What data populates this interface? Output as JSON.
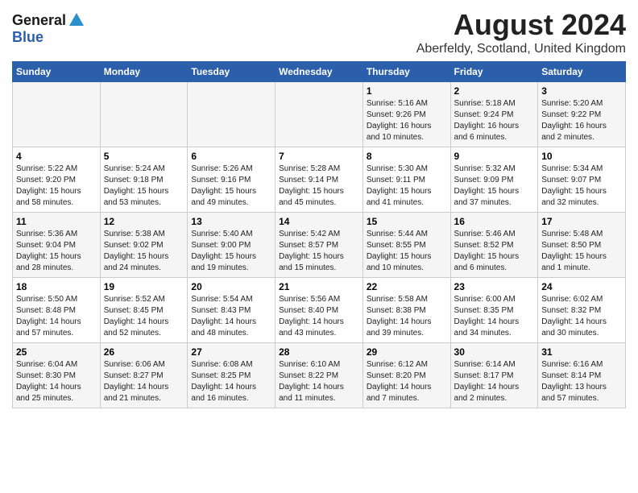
{
  "logo": {
    "general": "General",
    "blue": "Blue"
  },
  "title": "August 2024",
  "subtitle": "Aberfeldy, Scotland, United Kingdom",
  "days_of_week": [
    "Sunday",
    "Monday",
    "Tuesday",
    "Wednesday",
    "Thursday",
    "Friday",
    "Saturday"
  ],
  "weeks": [
    [
      {
        "day": "",
        "info": ""
      },
      {
        "day": "",
        "info": ""
      },
      {
        "day": "",
        "info": ""
      },
      {
        "day": "",
        "info": ""
      },
      {
        "day": "1",
        "info": "Sunrise: 5:16 AM\nSunset: 9:26 PM\nDaylight: 16 hours\nand 10 minutes."
      },
      {
        "day": "2",
        "info": "Sunrise: 5:18 AM\nSunset: 9:24 PM\nDaylight: 16 hours\nand 6 minutes."
      },
      {
        "day": "3",
        "info": "Sunrise: 5:20 AM\nSunset: 9:22 PM\nDaylight: 16 hours\nand 2 minutes."
      }
    ],
    [
      {
        "day": "4",
        "info": "Sunrise: 5:22 AM\nSunset: 9:20 PM\nDaylight: 15 hours\nand 58 minutes."
      },
      {
        "day": "5",
        "info": "Sunrise: 5:24 AM\nSunset: 9:18 PM\nDaylight: 15 hours\nand 53 minutes."
      },
      {
        "day": "6",
        "info": "Sunrise: 5:26 AM\nSunset: 9:16 PM\nDaylight: 15 hours\nand 49 minutes."
      },
      {
        "day": "7",
        "info": "Sunrise: 5:28 AM\nSunset: 9:14 PM\nDaylight: 15 hours\nand 45 minutes."
      },
      {
        "day": "8",
        "info": "Sunrise: 5:30 AM\nSunset: 9:11 PM\nDaylight: 15 hours\nand 41 minutes."
      },
      {
        "day": "9",
        "info": "Sunrise: 5:32 AM\nSunset: 9:09 PM\nDaylight: 15 hours\nand 37 minutes."
      },
      {
        "day": "10",
        "info": "Sunrise: 5:34 AM\nSunset: 9:07 PM\nDaylight: 15 hours\nand 32 minutes."
      }
    ],
    [
      {
        "day": "11",
        "info": "Sunrise: 5:36 AM\nSunset: 9:04 PM\nDaylight: 15 hours\nand 28 minutes."
      },
      {
        "day": "12",
        "info": "Sunrise: 5:38 AM\nSunset: 9:02 PM\nDaylight: 15 hours\nand 24 minutes."
      },
      {
        "day": "13",
        "info": "Sunrise: 5:40 AM\nSunset: 9:00 PM\nDaylight: 15 hours\nand 19 minutes."
      },
      {
        "day": "14",
        "info": "Sunrise: 5:42 AM\nSunset: 8:57 PM\nDaylight: 15 hours\nand 15 minutes."
      },
      {
        "day": "15",
        "info": "Sunrise: 5:44 AM\nSunset: 8:55 PM\nDaylight: 15 hours\nand 10 minutes."
      },
      {
        "day": "16",
        "info": "Sunrise: 5:46 AM\nSunset: 8:52 PM\nDaylight: 15 hours\nand 6 minutes."
      },
      {
        "day": "17",
        "info": "Sunrise: 5:48 AM\nSunset: 8:50 PM\nDaylight: 15 hours\nand 1 minute."
      }
    ],
    [
      {
        "day": "18",
        "info": "Sunrise: 5:50 AM\nSunset: 8:48 PM\nDaylight: 14 hours\nand 57 minutes."
      },
      {
        "day": "19",
        "info": "Sunrise: 5:52 AM\nSunset: 8:45 PM\nDaylight: 14 hours\nand 52 minutes."
      },
      {
        "day": "20",
        "info": "Sunrise: 5:54 AM\nSunset: 8:43 PM\nDaylight: 14 hours\nand 48 minutes."
      },
      {
        "day": "21",
        "info": "Sunrise: 5:56 AM\nSunset: 8:40 PM\nDaylight: 14 hours\nand 43 minutes."
      },
      {
        "day": "22",
        "info": "Sunrise: 5:58 AM\nSunset: 8:38 PM\nDaylight: 14 hours\nand 39 minutes."
      },
      {
        "day": "23",
        "info": "Sunrise: 6:00 AM\nSunset: 8:35 PM\nDaylight: 14 hours\nand 34 minutes."
      },
      {
        "day": "24",
        "info": "Sunrise: 6:02 AM\nSunset: 8:32 PM\nDaylight: 14 hours\nand 30 minutes."
      }
    ],
    [
      {
        "day": "25",
        "info": "Sunrise: 6:04 AM\nSunset: 8:30 PM\nDaylight: 14 hours\nand 25 minutes."
      },
      {
        "day": "26",
        "info": "Sunrise: 6:06 AM\nSunset: 8:27 PM\nDaylight: 14 hours\nand 21 minutes."
      },
      {
        "day": "27",
        "info": "Sunrise: 6:08 AM\nSunset: 8:25 PM\nDaylight: 14 hours\nand 16 minutes."
      },
      {
        "day": "28",
        "info": "Sunrise: 6:10 AM\nSunset: 8:22 PM\nDaylight: 14 hours\nand 11 minutes."
      },
      {
        "day": "29",
        "info": "Sunrise: 6:12 AM\nSunset: 8:20 PM\nDaylight: 14 hours\nand 7 minutes."
      },
      {
        "day": "30",
        "info": "Sunrise: 6:14 AM\nSunset: 8:17 PM\nDaylight: 14 hours\nand 2 minutes."
      },
      {
        "day": "31",
        "info": "Sunrise: 6:16 AM\nSunset: 8:14 PM\nDaylight: 13 hours\nand 57 minutes."
      }
    ]
  ]
}
